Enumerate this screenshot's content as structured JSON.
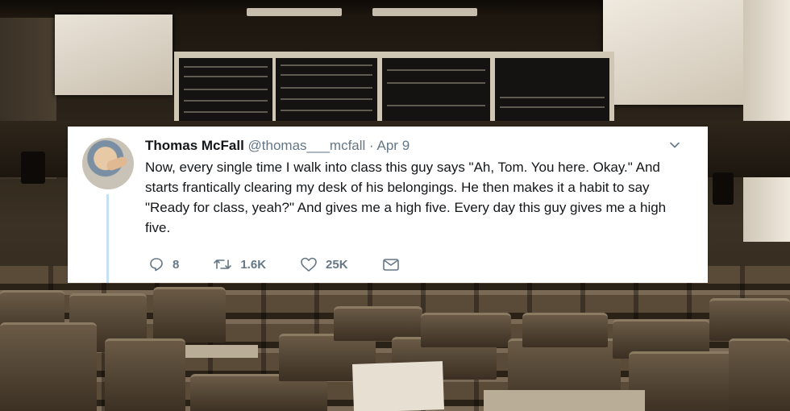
{
  "tweet": {
    "author_name": "Thomas McFall",
    "handle": "@thomas___mcfall",
    "separator": "·",
    "date": "Apr 9",
    "text": "Now, every single time I walk into class this guy says \"Ah, Tom. You here. Okay.\" And starts frantically clearing my desk of his belongings. He then makes it a habit to say \"Ready for class, yeah?\" And gives me a high five. Every day this guy gives me a high five.",
    "replies": "8",
    "retweets": "1.6K",
    "likes": "25K",
    "icons": {
      "reply": "reply-icon",
      "retweet": "retweet-icon",
      "like": "heart-icon",
      "dm": "envelope-icon",
      "menu": "chevron-down-icon"
    }
  },
  "colors": {
    "text_primary": "#14171a",
    "text_secondary": "#657786",
    "thread_line": "#c4e1f5",
    "card_background": "#ffffff"
  }
}
